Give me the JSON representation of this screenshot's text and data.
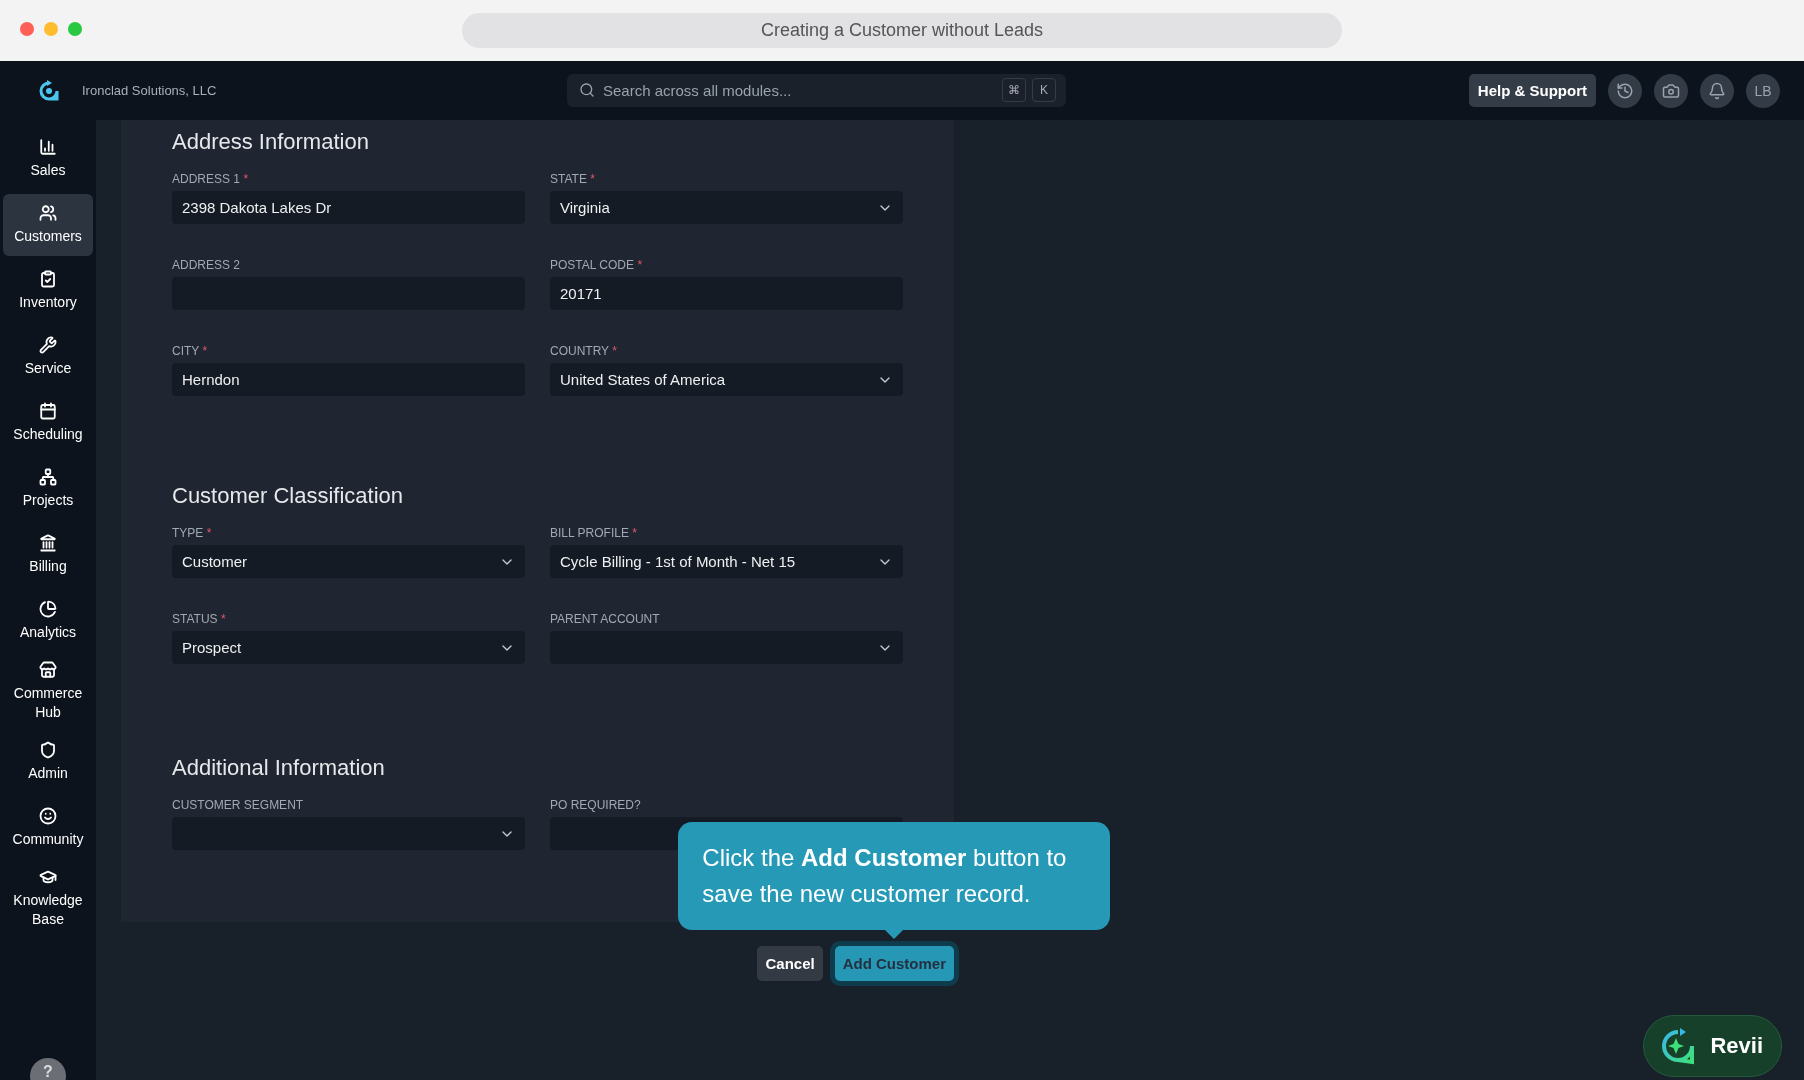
{
  "window": {
    "title": "Creating a Customer without Leads"
  },
  "header": {
    "company": "Ironclad Solutions, LLC",
    "search": {
      "placeholder": "Search across all modules...",
      "keys": [
        "⌘",
        "K"
      ]
    },
    "help_button": "Help & Support",
    "avatar": "LB"
  },
  "sidebar": {
    "items": [
      {
        "label": "Sales",
        "selected": false
      },
      {
        "label": "Customers",
        "selected": true
      },
      {
        "label": "Inventory",
        "selected": false
      },
      {
        "label": "Service",
        "selected": false
      },
      {
        "label": "Scheduling",
        "selected": false
      },
      {
        "label": "Projects",
        "selected": false
      },
      {
        "label": "Billing",
        "selected": false
      },
      {
        "label": "Analytics",
        "selected": false
      },
      {
        "label": "Commerce Hub",
        "selected": false
      },
      {
        "label": "Admin",
        "selected": false
      },
      {
        "label": "Community",
        "selected": false
      },
      {
        "label": "Knowledge Base",
        "selected": false
      }
    ],
    "help": "?"
  },
  "sections": [
    {
      "title": "Address Information",
      "fields": [
        {
          "label": "ADDRESS 1",
          "mark": "*",
          "kind": "text",
          "value": "2398 Dakota Lakes Dr"
        },
        {
          "label": "STATE",
          "mark": "*",
          "kind": "select",
          "value": "Virginia"
        },
        {
          "label": "ADDRESS 2",
          "kind": "text"
        },
        {
          "label": "POSTAL CODE",
          "mark": "*",
          "kind": "text",
          "value": "20171"
        },
        {
          "label": "CITY",
          "mark": "*",
          "kind": "text",
          "value": "Herndon"
        },
        {
          "label": "COUNTRY",
          "mark": "*",
          "kind": "select",
          "value": "United States of America"
        }
      ]
    },
    {
      "title": "Customer Classification",
      "fields": [
        {
          "label": "TYPE",
          "mark": "*",
          "kind": "select",
          "value": "Customer"
        },
        {
          "label": "BILL PROFILE",
          "mark": "*",
          "kind": "select",
          "value": "Cycle Billing - 1st of Month - Net 15"
        },
        {
          "label": "STATUS",
          "mark": "*",
          "kind": "select",
          "value": "Prospect"
        },
        {
          "label": "PARENT ACCOUNT",
          "kind": "select"
        }
      ]
    },
    {
      "title": "Additional Information",
      "fields": [
        {
          "label": "CUSTOMER SEGMENT",
          "kind": "select"
        },
        {
          "label": "PO REQUIRED?",
          "kind": "text"
        }
      ]
    }
  ],
  "actions": {
    "cancel": "Cancel",
    "submit": "Add Customer"
  },
  "tooltip": {
    "text": "Click the **Add Customer** button to save the new customer record."
  },
  "assistant": {
    "label": "Revii"
  }
}
